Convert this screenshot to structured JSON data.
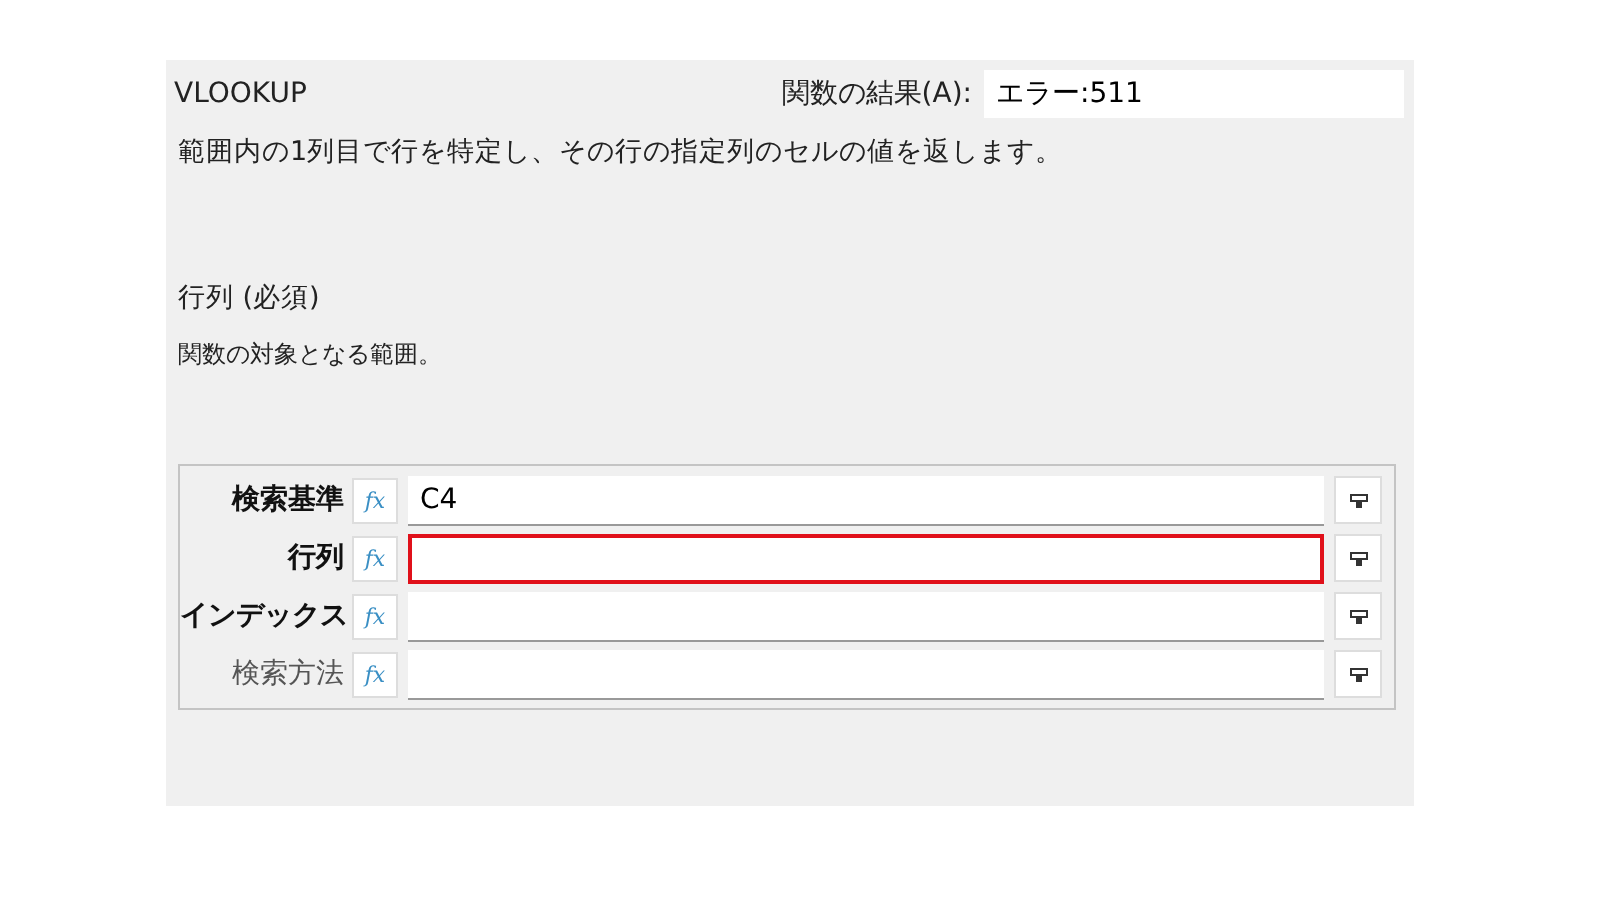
{
  "function_name": "VLOOKUP",
  "result": {
    "label": "関数の結果(A):",
    "value": "エラー:511"
  },
  "description": "範囲内の1列目で行を特定し、その行の指定列のセルの値を返します。",
  "argument_info": {
    "title": "行列 (必須)",
    "description": "関数の対象となる範囲。"
  },
  "arguments": [
    {
      "label": "検索基準",
      "required": true,
      "function_button": "fx",
      "value": "C4",
      "highlighted": false
    },
    {
      "label": "行列",
      "required": true,
      "function_button": "fx",
      "highlighted": true
    },
    {
      "label": "インデックス",
      "required": true,
      "function_button": "fx",
      "highlighted": false
    },
    {
      "label": "検索方法",
      "required": false,
      "function_button": "fx",
      "highlighted": false
    }
  ]
}
